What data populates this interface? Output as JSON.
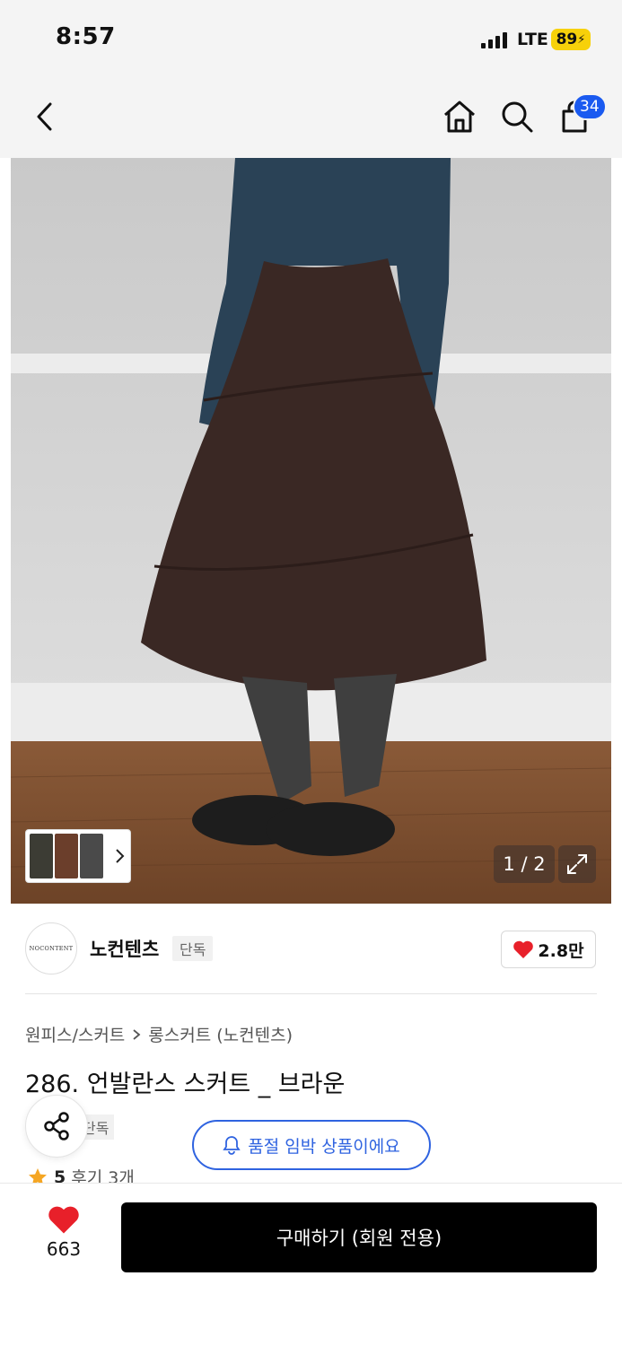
{
  "status_bar": {
    "time": "8:57",
    "network": "LTE",
    "battery": "89"
  },
  "nav": {
    "cart_count": "34"
  },
  "gallery": {
    "counter": "1 / 2"
  },
  "brand": {
    "logo_text": "NOCONTENT",
    "name": "노컨텐츠",
    "tag": "단독",
    "likes": "2.8만"
  },
  "breadcrumb": {
    "category": "원피스/스커트",
    "subcategory": "롱스커트 (노컨텐츠)"
  },
  "product": {
    "title": "286. 언발란스 스커트 _ 브라운",
    "exclusive_tag": "단독"
  },
  "alert": {
    "label": "품절 임박 상품이에요"
  },
  "rating": {
    "score": "5",
    "reviews": "후기 3개"
  },
  "bottom": {
    "wish_count": "663",
    "buy_label": "구매하기 (회원 전용)"
  },
  "colors": {
    "accent": "#2f63e0",
    "heart": "#e8202a",
    "badge": "#1a5af0",
    "buy": "#000000"
  }
}
